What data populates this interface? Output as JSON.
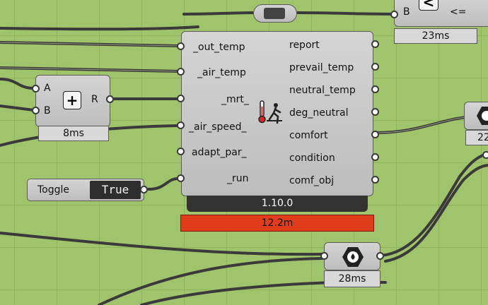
{
  "canvas": {
    "background": "#a0c46b"
  },
  "top_le": {
    "input_b": "B",
    "op_symbol": "<=",
    "time": "23ms"
  },
  "add": {
    "input_a": "A",
    "input_b": "B",
    "output": "R",
    "time": "8ms",
    "icon": "plus-icon"
  },
  "toggle": {
    "label": "Toggle",
    "value": "True"
  },
  "comfort": {
    "inputs": [
      "_out_temp",
      "_air_temp",
      "_mrt_",
      "_air_speed_",
      "adapt_par_",
      "_run"
    ],
    "outputs": [
      "report",
      "prevail_temp",
      "neutral_temp",
      "deg_neutral",
      "comfort",
      "condition",
      "comf_obj"
    ],
    "version": "1.10.0",
    "time": "12.2m",
    "icon": "thermometer-person-icon"
  },
  "right_node": {
    "time_partial": "22"
  },
  "bottom_node": {
    "time": "28ms",
    "icon": "hex-nut-drop-icon"
  },
  "colors": {
    "warning": "#e13d1c",
    "version_bar": "#333333",
    "wire": "#3a3a3a"
  }
}
